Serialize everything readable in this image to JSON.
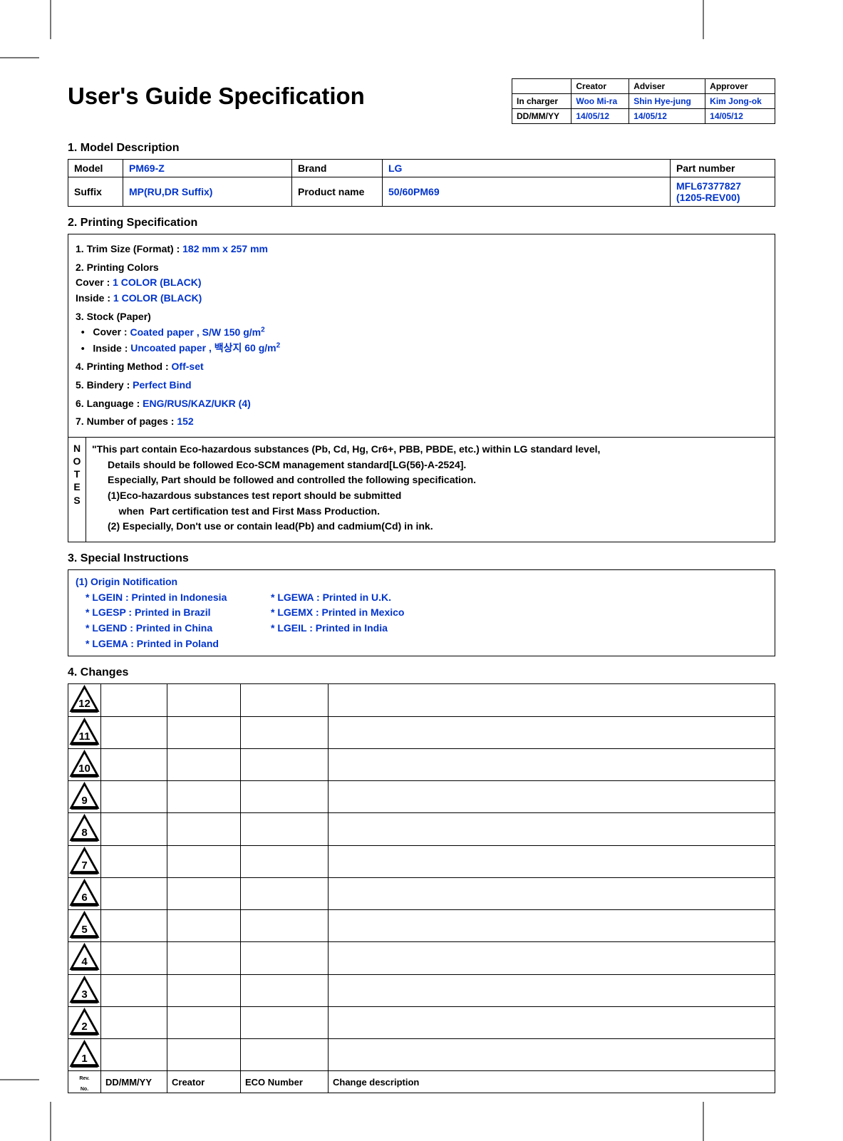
{
  "title": "User's Guide Specification",
  "approval": {
    "headers": [
      "",
      "Creator",
      "Adviser",
      "Approver"
    ],
    "row1_label": "In charger",
    "row1": [
      "Woo Mi-ra",
      "Shin Hye-jung",
      "Kim Jong-ok"
    ],
    "row2_label": "DD/MM/YY",
    "row2": [
      "14/05/12",
      "14/05/12",
      "14/05/12"
    ]
  },
  "sections": {
    "s1": "1. Model Description",
    "s2": "2. Printing Specification",
    "s3": "3. Special Instructions",
    "s4": "4. Changes"
  },
  "model": {
    "model_label": "Model",
    "model_val": "PM69-Z",
    "brand_label": "Brand",
    "brand_val": "LG",
    "partnum_label": "Part number",
    "suffix_label": "Suffix",
    "suffix_val": "MP(RU,DR Suffix)",
    "prodname_label": "Product name",
    "prodname_val": "50/60PM69",
    "partnum_val1": "MFL67377827",
    "partnum_val2": "(1205-REV00)"
  },
  "spec": {
    "l1a": "1. Trim Size (Format) : ",
    "l1b": "182 mm x 257 mm",
    "l2": "2. Printing Colors",
    "l2a": " Cover : ",
    "l2a_v": "1 COLOR (BLACK)",
    "l2b": " Inside : ",
    "l2b_v": "1 COLOR (BLACK)",
    "l3": "3. Stock (Paper)",
    "l3a": "Cover : ",
    "l3a_v": "Coated paper , S/W 150 g/m",
    "l3b": "Inside : ",
    "l3b_v": "Uncoated paper , 백상지 60 g/m",
    "l4a": "4. Printing Method : ",
    "l4b": "Off-set",
    "l5a": "5. Bindery  : ",
    "l5b": "Perfect Bind",
    "l6a": "6. Language : ",
    "l6b": "ENG/RUS/KAZ/UKR (4)",
    "l7a": "7. Number of pages : ",
    "l7b": "152"
  },
  "notes": {
    "label_chars": [
      "N",
      "O",
      "T",
      "E",
      "S"
    ],
    "n1": "\"This part contain Eco-hazardous substances (Pb, Cd, Hg, Cr6+, PBB, PBDE, etc.) within LG standard level,",
    "n2": "Details should be followed Eco-SCM management standard[LG(56)-A-2524].",
    "n3": "Especially, Part should be followed and controlled the following specification.",
    "n4": "(1)Eco-hazardous substances test report should be submitted",
    "n5": "    when  Part certification test and First Mass Production.",
    "n6": "(2) Especially, Don't use or contain lead(Pb) and cadmium(Cd) in ink."
  },
  "origin": {
    "title": "(1) Origin Notification",
    "col1": [
      "* LGEIN : Printed in Indonesia",
      "* LGESP : Printed in Brazil",
      "* LGEND : Printed in China",
      "* LGEMA : Printed in Poland"
    ],
    "col2": [
      "* LGEWA : Printed in U.K.",
      "* LGEMX : Printed in Mexico",
      "* LGEIL : Printed in India"
    ]
  },
  "changes": {
    "rev_numbers": [
      "12",
      "11",
      "10",
      "9",
      "8",
      "7",
      "6",
      "5",
      "4",
      "3",
      "2",
      "1"
    ],
    "headers": [
      "DD/MM/YY",
      "Creator",
      "ECO Number",
      "Change description"
    ],
    "revno_label": "Rev.\nNo."
  }
}
